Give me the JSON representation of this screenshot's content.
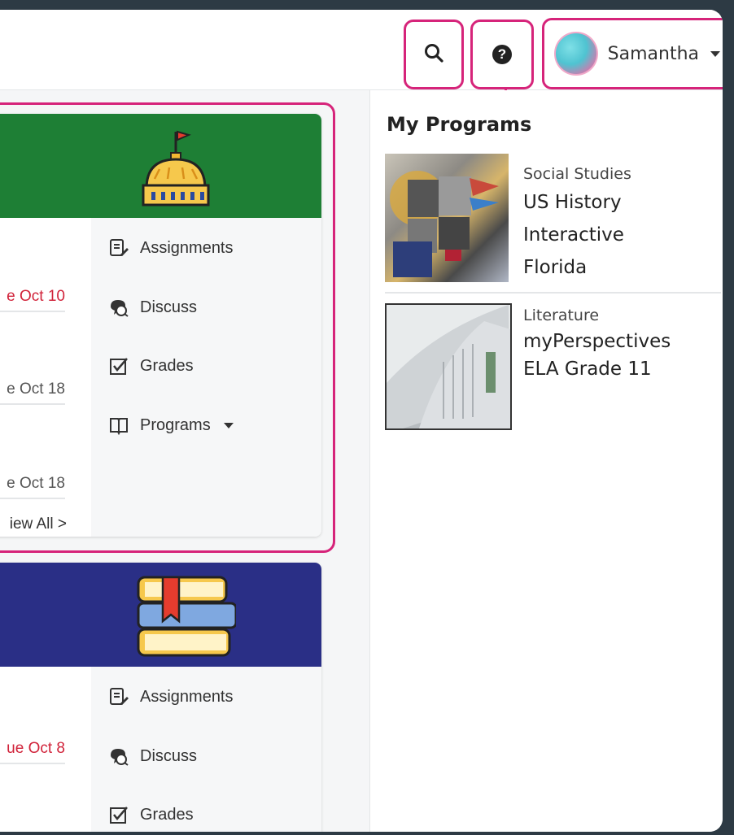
{
  "header": {
    "user_name": "Samantha",
    "icons": {
      "search": "search-icon",
      "help": "help-icon",
      "caret": "chevron-down-icon"
    }
  },
  "classes": [
    {
      "banner_color": "#1e7f35",
      "banner_icon": "capitol-building-icon",
      "due_items": [
        "e Oct 10",
        "e Oct 18",
        "e Oct 18"
      ],
      "due_red_index": 0,
      "view_all": "iew All >",
      "menu": [
        "Assignments",
        "Discuss",
        "Grades",
        "Programs"
      ]
    },
    {
      "banner_color": "#2a2f86",
      "banner_icon": "books-stack-icon",
      "due_items": [
        "ue Oct 8"
      ],
      "menu": [
        "Assignments",
        "Discuss",
        "Grades"
      ]
    }
  ],
  "my_programs": {
    "title": "My Programs",
    "items": [
      {
        "subject": "Social Studies",
        "title_lines": [
          "US History",
          "Interactive",
          "Florida"
        ]
      },
      {
        "subject": "Literature",
        "title_lines": [
          "myPerspectives",
          "ELA Grade 11"
        ]
      }
    ]
  },
  "colors": {
    "highlight": "#d6247a",
    "due_red": "#d1233a"
  }
}
